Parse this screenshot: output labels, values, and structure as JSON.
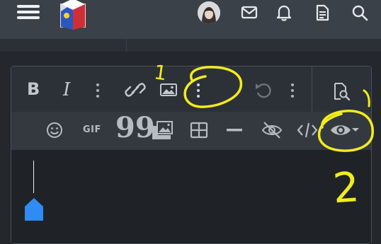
{
  "header": {
    "menu_icon": "hamburger-icon",
    "logo": "site-logo",
    "avatar": "user-avatar",
    "icons": [
      "mail-icon",
      "bell-icon",
      "document-icon",
      "search-icon"
    ]
  },
  "toolbar": {
    "row1": {
      "bold_label": "B",
      "italic_label": "I",
      "icons": [
        "more-vertical-icon",
        "link-icon",
        "image-icon",
        "more-vertical-icon",
        "undo-icon",
        "more-vertical-icon",
        "preview-icon"
      ]
    },
    "row2": {
      "gif_label": "GIF",
      "quote_label": "99",
      "icons": [
        "emoji-icon",
        "gif-icon",
        "quote-icon",
        "media-gallery-icon",
        "table-icon",
        "horizontal-rule-icon",
        "hide-icon",
        "code-icon",
        "spoiler-icon"
      ]
    }
  },
  "annotations": {
    "label_1": "1",
    "label_2": "2",
    "color": "#f2ec1b"
  },
  "colors": {
    "topbar": "#3b4148",
    "toolbar": "#2c3137",
    "toolbar_secondary": "#33393f",
    "editor_bg": "#1f2327",
    "handle": "#2f8cf2"
  }
}
